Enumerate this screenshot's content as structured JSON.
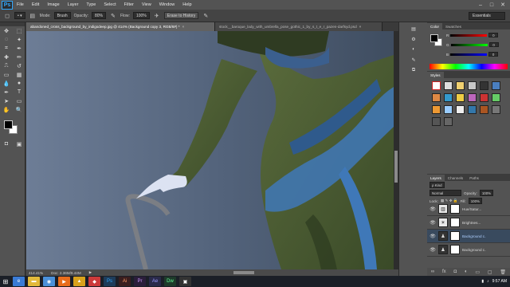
{
  "app": {
    "logo": "Ps"
  },
  "menu": [
    "File",
    "Edit",
    "Image",
    "Layer",
    "Type",
    "Select",
    "Filter",
    "View",
    "Window",
    "Help"
  ],
  "window_controls": {
    "minimize": "–",
    "maximize": "□",
    "close": "✕"
  },
  "options": {
    "mode_label": "Mode:",
    "mode_value": "Brush",
    "opacity_label": "Opacity:",
    "opacity_value": "80%",
    "flow_label": "Flow:",
    "flow_value": "100%",
    "erase_history_label": "Erase to History",
    "workspace": "Essentials"
  },
  "tabs": [
    {
      "label": "abandoned_cross_background_by_indigodeep.jpg @ 414% (Background copy 3, RGB/8#) *",
      "close": "×"
    },
    {
      "label": "stock__baroque_lady_with_umbrella_pose_gothic_1_by_s_t_e_r_pazen-darfsyd.psd",
      "close": "×"
    }
  ],
  "status": {
    "zoom": "414.41%",
    "doc": "Doc: 2.36M/9.44M"
  },
  "color_panel": {
    "tabs": [
      "Color",
      "Swatches"
    ],
    "sliders": [
      {
        "label": "R",
        "value": "0",
        "color": "#d33"
      },
      {
        "label": "G",
        "value": "0",
        "color": "#3c3"
      },
      {
        "label": "B",
        "value": "0",
        "color": "#33d"
      }
    ]
  },
  "styles_panel": {
    "tab": "Styles"
  },
  "layers_panel": {
    "tabs": [
      "Layers",
      "Channels",
      "Paths"
    ],
    "kind_label": "ρ Kind",
    "blend_mode": "Normal",
    "opacity_label": "Opacity:",
    "opacity_value": "100%",
    "lock_label": "Lock:",
    "fill_label": "Fill:",
    "fill_value": "100%",
    "layers": [
      {
        "name": "Hue/Satur...",
        "selected": false
      },
      {
        "name": "Brightnes...",
        "selected": false
      },
      {
        "name": "Background c...",
        "selected": true
      },
      {
        "name": "Background c...",
        "selected": false
      }
    ]
  },
  "taskbar": {
    "time": "9:57 AM"
  },
  "colors": {
    "canvas_bg": "#5f6e85",
    "dress": "#4e5f35",
    "accent_blue": "#3f78b8"
  }
}
